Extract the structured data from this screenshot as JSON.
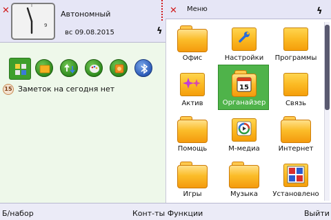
{
  "status": {
    "profile": "Автономный",
    "date": "вс 09.08.2015"
  },
  "clock": {
    "hour_mark": "9"
  },
  "notes": {
    "icon_text": "15",
    "text": "Заметок на сегодня нет"
  },
  "menu": {
    "title": "Меню",
    "items": [
      {
        "label": "Офис",
        "icon": "office-folder-icon"
      },
      {
        "label": "Настройки",
        "icon": "settings-wrench-icon"
      },
      {
        "label": "Программы",
        "icon": "programs-folder-icon"
      },
      {
        "label": "Актив",
        "icon": "active-sparkle-icon"
      },
      {
        "label": "Органайзер",
        "icon": "organizer-calendar-icon",
        "calendar_day": "15"
      },
      {
        "label": "Связь",
        "icon": "connectivity-folder-icon"
      },
      {
        "label": "Помощь",
        "icon": "help-folder-icon"
      },
      {
        "label": "М-медиа",
        "icon": "media-player-icon"
      },
      {
        "label": "Интернет",
        "icon": "internet-folder-icon"
      },
      {
        "label": "Игры",
        "icon": "games-folder-icon"
      },
      {
        "label": "Музыка",
        "icon": "music-folder-icon"
      },
      {
        "label": "Установлено",
        "icon": "installed-apps-icon"
      }
    ],
    "selected_index": 4,
    "scroll_fraction": 0.48
  },
  "softkeys": {
    "left": "Б/набор",
    "center": "Конт-ты Функции",
    "right": "Выйти"
  },
  "colors": {
    "accent_green": "#4fb34a",
    "close_red": "#d01818",
    "folder_orange": "#f8b21d",
    "header_lavender": "#e6e6f6",
    "left_background": "#eef8ea"
  }
}
